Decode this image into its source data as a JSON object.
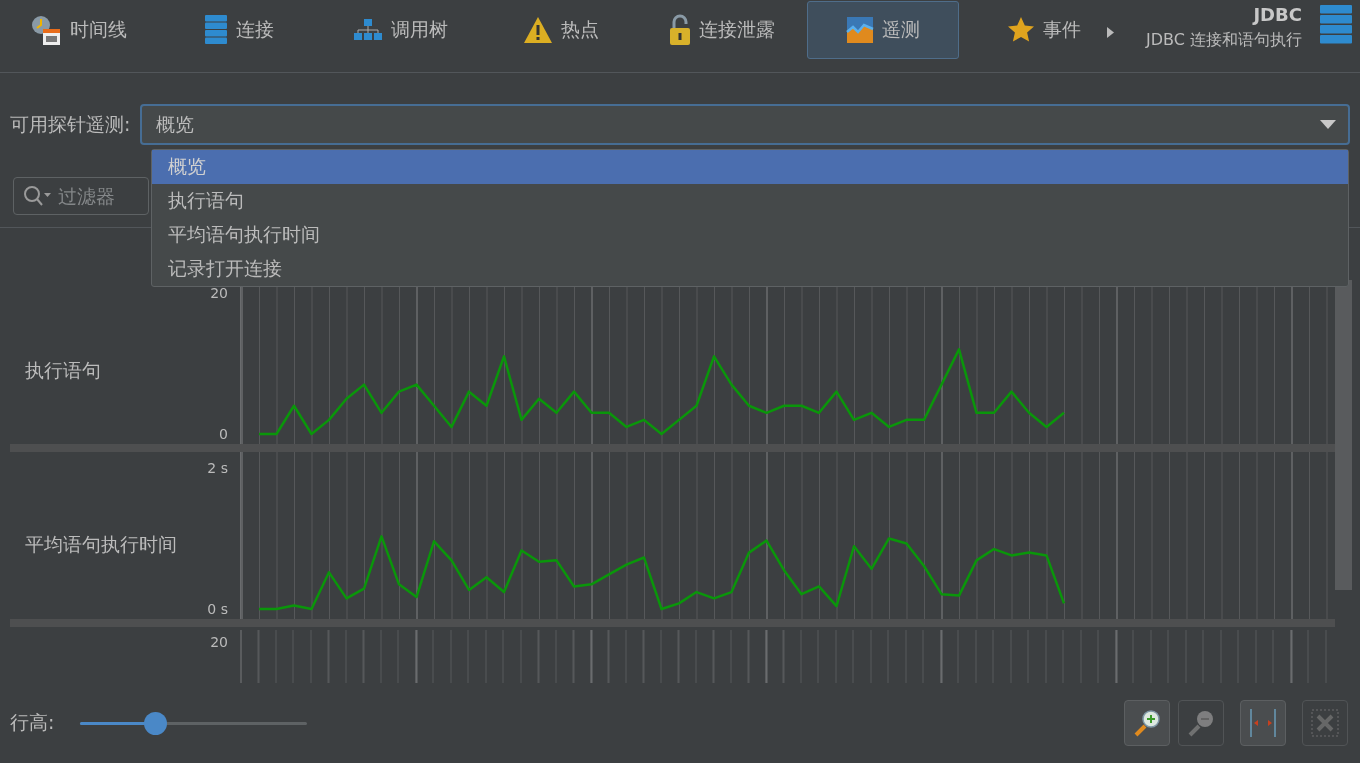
{
  "tabs": [
    {
      "label": "时间线",
      "kind": "timeline",
      "selected": false
    },
    {
      "label": "连接",
      "kind": "database",
      "selected": false
    },
    {
      "label": "调用树",
      "kind": "tree",
      "selected": false
    },
    {
      "label": "热点",
      "kind": "warning",
      "selected": false
    },
    {
      "label": "连接泄露",
      "kind": "lock",
      "selected": false
    },
    {
      "label": "遥测",
      "kind": "telemetry",
      "selected": true
    },
    {
      "label": "事件",
      "kind": "star",
      "selected": false
    }
  ],
  "section_header": {
    "title": "JDBC",
    "subtitle": "JDBC 连接和语句执行"
  },
  "probe_selector": {
    "label": "可用探针遥测:",
    "value": "概览",
    "open": true,
    "options": [
      {
        "label": "概览",
        "selected": true
      },
      {
        "label": "执行语句",
        "selected": false
      },
      {
        "label": "平均语句执行时间",
        "selected": false
      },
      {
        "label": "记录打开连接",
        "selected": false
      }
    ]
  },
  "filter": {
    "placeholder": "过滤器"
  },
  "telemetries": [
    {
      "chart_data": {
        "type": "line",
        "title": "执行语句",
        "grid": true,
        "ylim": [
          -1.42,
          29.2
        ],
        "yticks": [
          {
            "value": 0,
            "label": "0"
          },
          {
            "value": 20,
            "label": "20"
          }
        ],
        "series": [
          {
            "color": "#0a960a",
            "values": [
              0,
              0,
              4,
              0,
              2,
              5,
              7,
              3,
              6,
              7,
              4,
              1,
              6,
              4,
              11,
              2,
              5,
              3,
              6,
              3,
              3,
              1,
              2,
              0,
              2,
              4,
              11,
              7,
              4,
              3,
              4,
              4,
              3,
              6,
              2,
              3,
              1,
              2,
              2,
              7,
              12,
              3,
              3,
              6,
              3,
              1,
              3
            ]
          }
        ]
      }
    },
    {
      "chart_data": {
        "type": "line",
        "title": "平均语句执行时间",
        "grid": true,
        "ylim": [
          -0.142,
          2.227
        ],
        "yticks": [
          {
            "value": 0,
            "label": "0 s"
          },
          {
            "value": 2,
            "label": "2 s"
          }
        ],
        "series": [
          {
            "color": "#0a960a",
            "values": [
              0,
              0,
              0.05,
              0,
              0.52,
              0.15,
              0.29,
              1.03,
              0.35,
              0.17,
              0.96,
              0.69,
              0.27,
              0.45,
              0.24,
              0.83,
              0.67,
              0.69,
              0.32,
              0.35,
              0.49,
              0.63,
              0.73,
              0,
              0.08,
              0.24,
              0.15,
              0.24,
              0.8,
              0.97,
              0.55,
              0.21,
              0.32,
              0.04,
              0.89,
              0.57,
              1.0,
              0.93,
              0.61,
              0.21,
              0.19,
              0.69,
              0.85,
              0.76,
              0.8,
              0.76,
              0.08
            ]
          }
        ]
      }
    }
  ],
  "partial_row": {
    "tick": "20"
  },
  "row_height": {
    "label": "行高:",
    "level": 0.33
  },
  "buttons": [
    {
      "kind": "zoom-in",
      "disabled": false
    },
    {
      "kind": "zoom-out",
      "disabled": true
    },
    {
      "kind": "fit-width",
      "disabled": false
    },
    {
      "kind": "remove-selection",
      "disabled": true
    }
  ]
}
